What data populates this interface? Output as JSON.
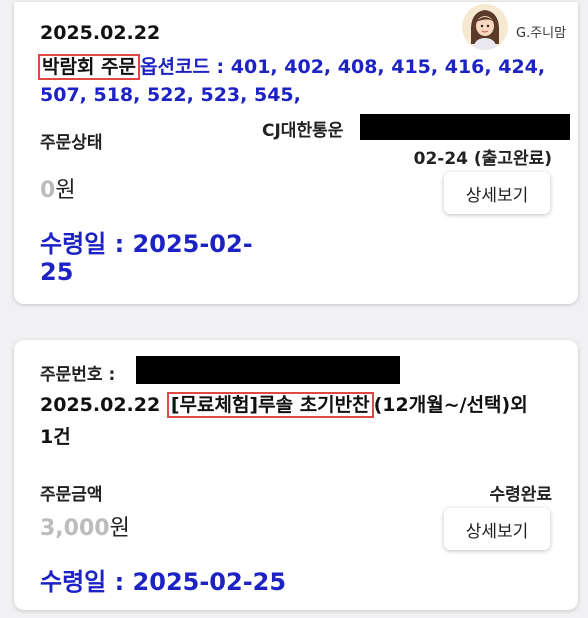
{
  "watermark": {
    "text": "G.주니맘"
  },
  "order1": {
    "date": "2025.02.22",
    "tag": "박람회 주문",
    "options_line1": "옵션코드 : 401, 402, 408, 415, 416, 424,",
    "options_line2": "507, 518, 522, 523, 545,",
    "status_label": "주문상태",
    "courier": "CJ대한통운",
    "ship_status": "02-24 (출고완료)",
    "amount": "0",
    "amount_unit": "원",
    "detail_button": "상세보기",
    "receive_line1": "수령일 : 2025-02-",
    "receive_line2": "25"
  },
  "order2": {
    "number_label": "주문번호 :",
    "date": "2025.02.22",
    "product_tag": "[무료체험]루솔 초기반찬",
    "product_rest": "(12개월~/선택)외",
    "product_line2": "1건",
    "amount_label": "주문금액",
    "status": "수령완료",
    "amount": "3,000",
    "amount_unit": "원",
    "detail_button": "상세보기",
    "receive": "수령일 : 2025-02-25"
  },
  "colors": {
    "accent_blue": "#1c22c4",
    "highlight_red": "#e04848",
    "muted_grey": "#bcbcbc"
  }
}
